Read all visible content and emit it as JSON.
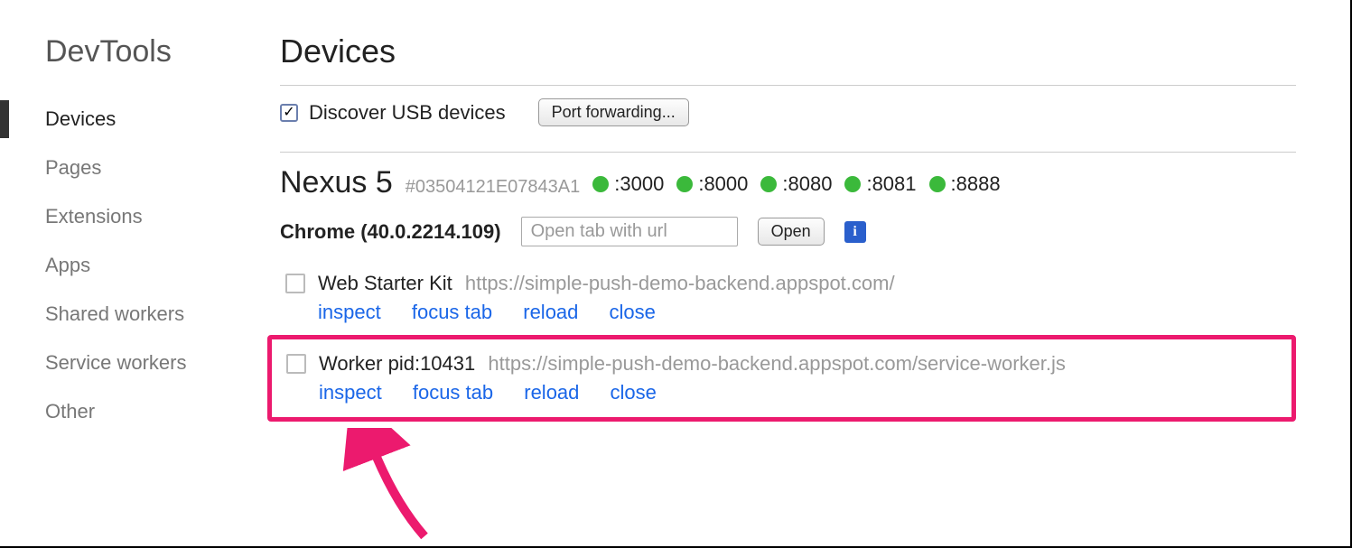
{
  "sidebar": {
    "title": "DevTools",
    "items": [
      "Devices",
      "Pages",
      "Extensions",
      "Apps",
      "Shared workers",
      "Service workers",
      "Other"
    ],
    "activeIndex": 0
  },
  "main": {
    "title": "Devices",
    "discover": {
      "label": "Discover USB devices",
      "checked": true
    },
    "portForwarding": "Port forwarding...",
    "device": {
      "name": "Nexus 5",
      "id": "#03504121E07843A1",
      "ports": [
        ":3000",
        ":8000",
        ":8080",
        ":8081",
        ":8888"
      ]
    },
    "browser": {
      "label": "Chrome (40.0.2214.109)",
      "placeholder": "Open tab with url",
      "openLabel": "Open"
    },
    "entries": [
      {
        "title": "Web Starter Kit",
        "url": "https://simple-push-demo-backend.appspot.com/",
        "highlighted": false
      },
      {
        "title": "Worker pid:10431",
        "url": "https://simple-push-demo-backend.appspot.com/service-worker.js",
        "highlighted": true
      }
    ],
    "actions": {
      "inspect": "inspect",
      "focusTab": "focus tab",
      "reload": "reload",
      "close": "close"
    },
    "infoIconGlyph": "i"
  }
}
